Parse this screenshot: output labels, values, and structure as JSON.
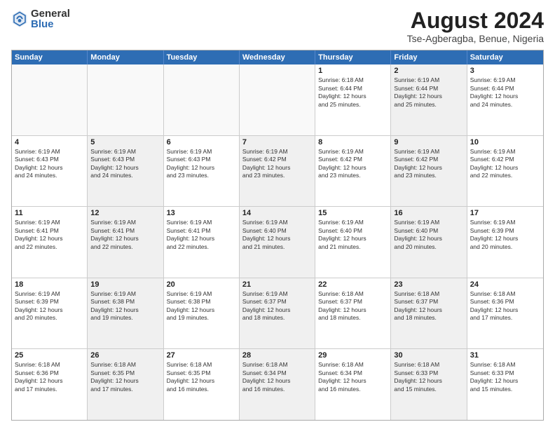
{
  "logo": {
    "general": "General",
    "blue": "Blue"
  },
  "title": {
    "month_year": "August 2024",
    "location": "Tse-Agberagba, Benue, Nigeria"
  },
  "days_of_week": [
    "Sunday",
    "Monday",
    "Tuesday",
    "Wednesday",
    "Thursday",
    "Friday",
    "Saturday"
  ],
  "weeks": [
    [
      {
        "day": "",
        "text": "",
        "shaded": false,
        "empty": true
      },
      {
        "day": "",
        "text": "",
        "shaded": false,
        "empty": true
      },
      {
        "day": "",
        "text": "",
        "shaded": false,
        "empty": true
      },
      {
        "day": "",
        "text": "",
        "shaded": false,
        "empty": true
      },
      {
        "day": "1",
        "text": "Sunrise: 6:18 AM\nSunset: 6:44 PM\nDaylight: 12 hours\nand 25 minutes.",
        "shaded": false,
        "empty": false
      },
      {
        "day": "2",
        "text": "Sunrise: 6:19 AM\nSunset: 6:44 PM\nDaylight: 12 hours\nand 25 minutes.",
        "shaded": true,
        "empty": false
      },
      {
        "day": "3",
        "text": "Sunrise: 6:19 AM\nSunset: 6:44 PM\nDaylight: 12 hours\nand 24 minutes.",
        "shaded": false,
        "empty": false
      }
    ],
    [
      {
        "day": "4",
        "text": "Sunrise: 6:19 AM\nSunset: 6:43 PM\nDaylight: 12 hours\nand 24 minutes.",
        "shaded": false,
        "empty": false
      },
      {
        "day": "5",
        "text": "Sunrise: 6:19 AM\nSunset: 6:43 PM\nDaylight: 12 hours\nand 24 minutes.",
        "shaded": true,
        "empty": false
      },
      {
        "day": "6",
        "text": "Sunrise: 6:19 AM\nSunset: 6:43 PM\nDaylight: 12 hours\nand 23 minutes.",
        "shaded": false,
        "empty": false
      },
      {
        "day": "7",
        "text": "Sunrise: 6:19 AM\nSunset: 6:42 PM\nDaylight: 12 hours\nand 23 minutes.",
        "shaded": true,
        "empty": false
      },
      {
        "day": "8",
        "text": "Sunrise: 6:19 AM\nSunset: 6:42 PM\nDaylight: 12 hours\nand 23 minutes.",
        "shaded": false,
        "empty": false
      },
      {
        "day": "9",
        "text": "Sunrise: 6:19 AM\nSunset: 6:42 PM\nDaylight: 12 hours\nand 23 minutes.",
        "shaded": true,
        "empty": false
      },
      {
        "day": "10",
        "text": "Sunrise: 6:19 AM\nSunset: 6:42 PM\nDaylight: 12 hours\nand 22 minutes.",
        "shaded": false,
        "empty": false
      }
    ],
    [
      {
        "day": "11",
        "text": "Sunrise: 6:19 AM\nSunset: 6:41 PM\nDaylight: 12 hours\nand 22 minutes.",
        "shaded": false,
        "empty": false
      },
      {
        "day": "12",
        "text": "Sunrise: 6:19 AM\nSunset: 6:41 PM\nDaylight: 12 hours\nand 22 minutes.",
        "shaded": true,
        "empty": false
      },
      {
        "day": "13",
        "text": "Sunrise: 6:19 AM\nSunset: 6:41 PM\nDaylight: 12 hours\nand 22 minutes.",
        "shaded": false,
        "empty": false
      },
      {
        "day": "14",
        "text": "Sunrise: 6:19 AM\nSunset: 6:40 PM\nDaylight: 12 hours\nand 21 minutes.",
        "shaded": true,
        "empty": false
      },
      {
        "day": "15",
        "text": "Sunrise: 6:19 AM\nSunset: 6:40 PM\nDaylight: 12 hours\nand 21 minutes.",
        "shaded": false,
        "empty": false
      },
      {
        "day": "16",
        "text": "Sunrise: 6:19 AM\nSunset: 6:40 PM\nDaylight: 12 hours\nand 20 minutes.",
        "shaded": true,
        "empty": false
      },
      {
        "day": "17",
        "text": "Sunrise: 6:19 AM\nSunset: 6:39 PM\nDaylight: 12 hours\nand 20 minutes.",
        "shaded": false,
        "empty": false
      }
    ],
    [
      {
        "day": "18",
        "text": "Sunrise: 6:19 AM\nSunset: 6:39 PM\nDaylight: 12 hours\nand 20 minutes.",
        "shaded": false,
        "empty": false
      },
      {
        "day": "19",
        "text": "Sunrise: 6:19 AM\nSunset: 6:38 PM\nDaylight: 12 hours\nand 19 minutes.",
        "shaded": true,
        "empty": false
      },
      {
        "day": "20",
        "text": "Sunrise: 6:19 AM\nSunset: 6:38 PM\nDaylight: 12 hours\nand 19 minutes.",
        "shaded": false,
        "empty": false
      },
      {
        "day": "21",
        "text": "Sunrise: 6:19 AM\nSunset: 6:37 PM\nDaylight: 12 hours\nand 18 minutes.",
        "shaded": true,
        "empty": false
      },
      {
        "day": "22",
        "text": "Sunrise: 6:18 AM\nSunset: 6:37 PM\nDaylight: 12 hours\nand 18 minutes.",
        "shaded": false,
        "empty": false
      },
      {
        "day": "23",
        "text": "Sunrise: 6:18 AM\nSunset: 6:37 PM\nDaylight: 12 hours\nand 18 minutes.",
        "shaded": true,
        "empty": false
      },
      {
        "day": "24",
        "text": "Sunrise: 6:18 AM\nSunset: 6:36 PM\nDaylight: 12 hours\nand 17 minutes.",
        "shaded": false,
        "empty": false
      }
    ],
    [
      {
        "day": "25",
        "text": "Sunrise: 6:18 AM\nSunset: 6:36 PM\nDaylight: 12 hours\nand 17 minutes.",
        "shaded": false,
        "empty": false
      },
      {
        "day": "26",
        "text": "Sunrise: 6:18 AM\nSunset: 6:35 PM\nDaylight: 12 hours\nand 17 minutes.",
        "shaded": true,
        "empty": false
      },
      {
        "day": "27",
        "text": "Sunrise: 6:18 AM\nSunset: 6:35 PM\nDaylight: 12 hours\nand 16 minutes.",
        "shaded": false,
        "empty": false
      },
      {
        "day": "28",
        "text": "Sunrise: 6:18 AM\nSunset: 6:34 PM\nDaylight: 12 hours\nand 16 minutes.",
        "shaded": true,
        "empty": false
      },
      {
        "day": "29",
        "text": "Sunrise: 6:18 AM\nSunset: 6:34 PM\nDaylight: 12 hours\nand 16 minutes.",
        "shaded": false,
        "empty": false
      },
      {
        "day": "30",
        "text": "Sunrise: 6:18 AM\nSunset: 6:33 PM\nDaylight: 12 hours\nand 15 minutes.",
        "shaded": true,
        "empty": false
      },
      {
        "day": "31",
        "text": "Sunrise: 6:18 AM\nSunset: 6:33 PM\nDaylight: 12 hours\nand 15 minutes.",
        "shaded": false,
        "empty": false
      }
    ]
  ]
}
